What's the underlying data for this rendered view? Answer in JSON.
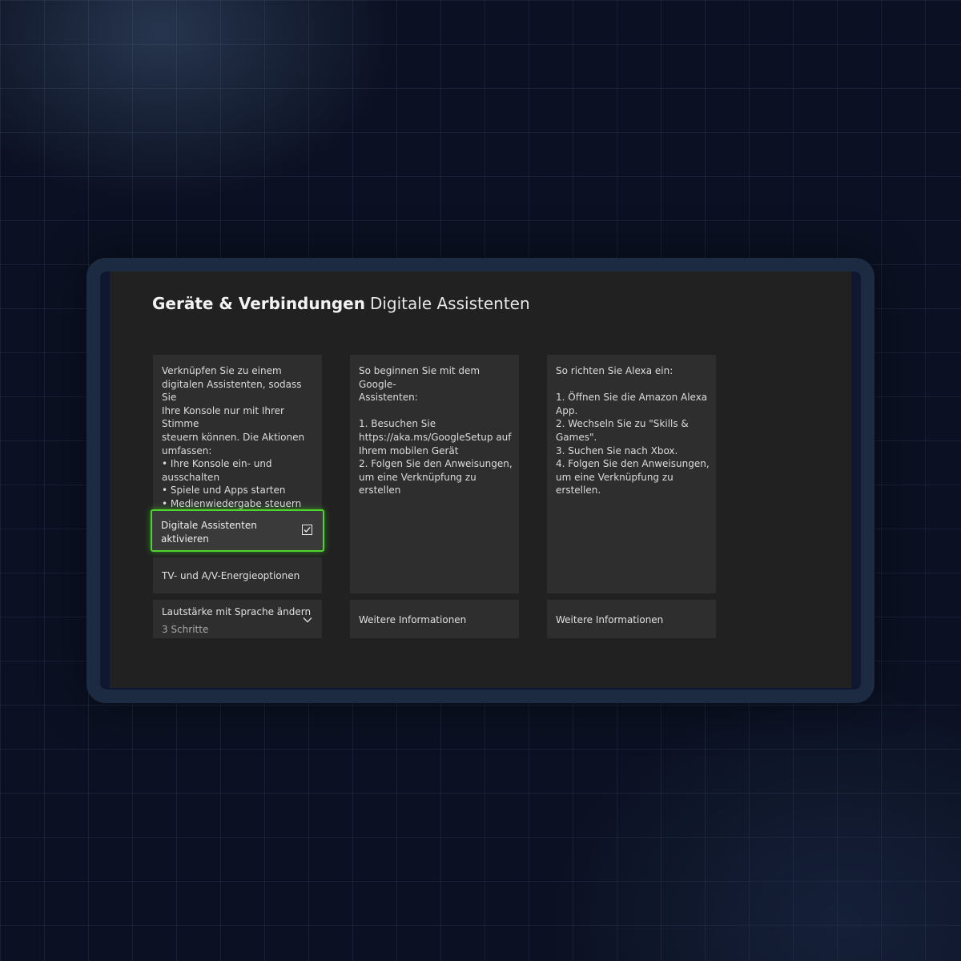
{
  "header": {
    "section": "Geräte & Verbindungen",
    "title": "Digitale Assistenten"
  },
  "intro": {
    "text": "Verknüpfen Sie zu einem\ndigitalen Assistenten, sodass Sie\nIhre Konsole nur mit Ihrer Stimme\nsteuern können. Die Aktionen\numfassen:\n• Ihre Konsole ein- und\nausschalten\n• Spiele und Apps starten\n• Medienwiedergabe steuern\n• Spiele aufzeichnen"
  },
  "toggle": {
    "label": "Digitale Assistenten aktivieren",
    "checked": true
  },
  "tv_energy": {
    "label": "TV- und A/V-Energieoptionen"
  },
  "volume": {
    "label": "Lautstärke mit Sprache ändern",
    "value": "3 Schritte"
  },
  "google": {
    "text": "So beginnen Sie mit dem Google-\nAssistenten:\n\n1. Besuchen Sie\nhttps://aka.ms/GoogleSetup auf\nIhrem mobilen Gerät\n2. Folgen Sie den Anweisungen,\num eine Verknüpfung zu erstellen",
    "more_label": "Weitere Informationen"
  },
  "alexa": {
    "text": "So richten Sie Alexa ein:\n\n1. Öffnen Sie die Amazon Alexa\nApp.\n2. Wechseln Sie zu \"Skills &\nGames\".\n3. Suchen Sie nach Xbox.\n4. Folgen Sie den Anweisungen,\num eine Verknüpfung zu\nerstellen.",
    "more_label": "Weitere Informationen"
  },
  "icons": {
    "checkbox": "checkbox-checked-icon",
    "expand": "chevron-down-icon"
  },
  "colors": {
    "focus": "#4ed62a",
    "screen_bg": "#212121",
    "tile_bg": "#2e2e2e"
  }
}
